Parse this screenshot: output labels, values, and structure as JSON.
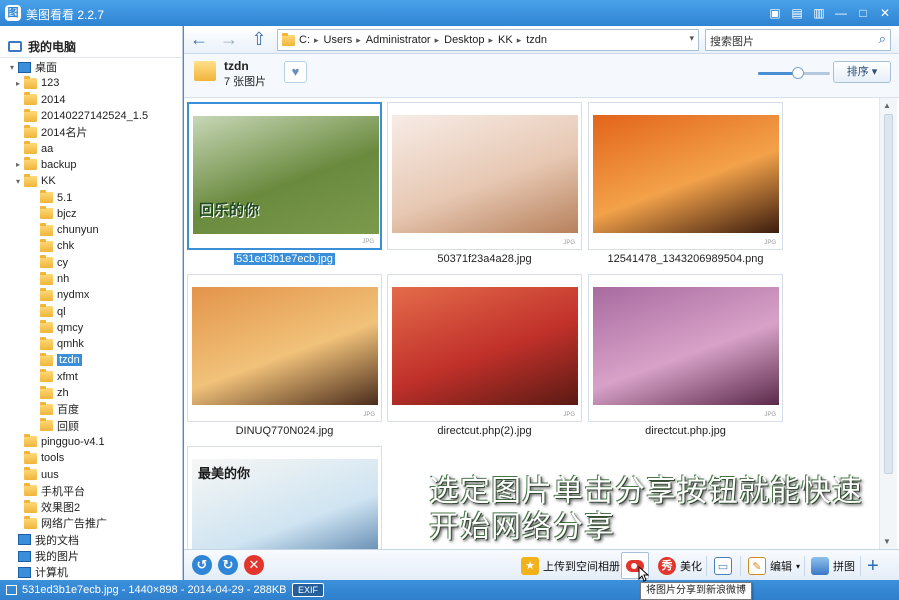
{
  "window": {
    "app_icon": "图",
    "title": "美图看看 2.2.7",
    "buttons": [
      "chat-icon",
      "skin-icon",
      "shirt-icon",
      "minimize-icon",
      "maximize-icon",
      "close-icon"
    ]
  },
  "sidebar": {
    "header": "我的电脑",
    "tree": [
      {
        "label": "桌面",
        "type": "desktop",
        "arrow": "▾",
        "indent": 0
      },
      {
        "label": "123",
        "arrow": "▸",
        "indent": 1
      },
      {
        "label": "2014",
        "arrow": "",
        "indent": 1
      },
      {
        "label": "20140227142524_1.5",
        "arrow": "",
        "indent": 1
      },
      {
        "label": "2014名片",
        "arrow": "",
        "indent": 1
      },
      {
        "label": "aa",
        "arrow": "",
        "indent": 1
      },
      {
        "label": "backup",
        "arrow": "▸",
        "indent": 1
      },
      {
        "label": "KK",
        "arrow": "▾",
        "indent": 1
      },
      {
        "label": "5.1",
        "arrow": "",
        "indent": 2
      },
      {
        "label": "bjcz",
        "arrow": "",
        "indent": 2
      },
      {
        "label": "chunyun",
        "arrow": "",
        "indent": 2
      },
      {
        "label": "chk",
        "arrow": "",
        "indent": 2
      },
      {
        "label": "cy",
        "arrow": "",
        "indent": 2
      },
      {
        "label": "nh",
        "arrow": "",
        "indent": 2
      },
      {
        "label": "nydmx",
        "arrow": "",
        "indent": 2
      },
      {
        "label": "ql",
        "arrow": "",
        "indent": 2
      },
      {
        "label": "qmcy",
        "arrow": "",
        "indent": 2
      },
      {
        "label": "qmhk",
        "arrow": "",
        "indent": 2
      },
      {
        "label": "tzdn",
        "arrow": "",
        "indent": 2,
        "selected": true
      },
      {
        "label": "xfmt",
        "arrow": "",
        "indent": 2
      },
      {
        "label": "zh",
        "arrow": "",
        "indent": 2
      },
      {
        "label": "百度",
        "arrow": "",
        "indent": 2
      },
      {
        "label": "回顾",
        "arrow": "",
        "indent": 2
      },
      {
        "label": "pingguo-v4.1",
        "arrow": "",
        "indent": 1
      },
      {
        "label": "tools",
        "arrow": "",
        "indent": 1
      },
      {
        "label": "uus",
        "arrow": "",
        "indent": 1
      },
      {
        "label": "手机平台",
        "arrow": "",
        "indent": 1
      },
      {
        "label": "效果图2",
        "arrow": "",
        "indent": 1
      },
      {
        "label": "网络广告推广",
        "arrow": "",
        "indent": 1
      },
      {
        "label": "我的文档",
        "type": "special",
        "arrow": "",
        "indent": 0
      },
      {
        "label": "我的图片",
        "type": "special",
        "arrow": "",
        "indent": 0
      },
      {
        "label": "计算机",
        "type": "special",
        "arrow": "",
        "indent": 0
      }
    ]
  },
  "nav": {
    "back": "←",
    "forward": "→",
    "up": "⇧",
    "path": [
      "C:",
      "Users",
      "Administrator",
      "Desktop",
      "KK",
      "tzdn"
    ],
    "path_sep": "▸",
    "dropdown": "▾",
    "search_placeholder": "搜索图片"
  },
  "folder": {
    "name": "tzdn",
    "count": "7 张图片",
    "fav_icon": "♥",
    "sort_label": "排序 ▾",
    "zoom_level": 0.55
  },
  "gallery": {
    "jpg_mark": "JPG",
    "images": [
      {
        "file": "531ed3b1e7ecb.jpg",
        "selected": true,
        "colors": [
          "#6a8a3e",
          "#c7d7b6",
          "#7b9a4c"
        ],
        "overlay": "回乐的你"
      },
      {
        "file": "50371f23a4a28.jpg",
        "colors": [
          "#e7c8b3",
          "#f7ece6",
          "#b7815c"
        ]
      },
      {
        "file": "12541478_1343206989504.png",
        "colors": [
          "#f3a24a",
          "#e2641a",
          "#3a1c0e"
        ]
      },
      {
        "file": "DINUQ770N024.jpg",
        "colors": [
          "#f1c27a",
          "#e3944a",
          "#4a2c1c"
        ]
      },
      {
        "file": "directcut.php(2).jpg",
        "colors": [
          "#c0302a",
          "#e46b4a",
          "#5a1a14"
        ]
      },
      {
        "file": "directcut.php.jpg",
        "colors": [
          "#d8a2c8",
          "#a86aa0",
          "#5a2a4a"
        ]
      },
      {
        "file": "",
        "colors": [
          "#cfe4f2",
          "#f7f7f4",
          "#3a6a9a"
        ],
        "overlay": "最美的你"
      }
    ],
    "overlay_lines": [
      "选定图片单击分享按钮就能快速",
      "开始网络分享"
    ]
  },
  "toolbar": {
    "rotate_left": "↺",
    "rotate_right": "↻",
    "delete": "✕",
    "upload": "上传到空间相册",
    "beautify": "美化",
    "beautify_glyph": "秀",
    "edit": "编辑",
    "edit_arrow": "▾",
    "collage": "拼图",
    "add": "+"
  },
  "status": {
    "text": "531ed3b1e7ecb.jpg - 1440×898 - 2014-04-29 - 288KB",
    "exif": "EXIF",
    "tooltip": "将图片分享到新浪微博"
  },
  "colors": {
    "accent": "#3b8fd8",
    "titlebar": "#2f84d2"
  }
}
